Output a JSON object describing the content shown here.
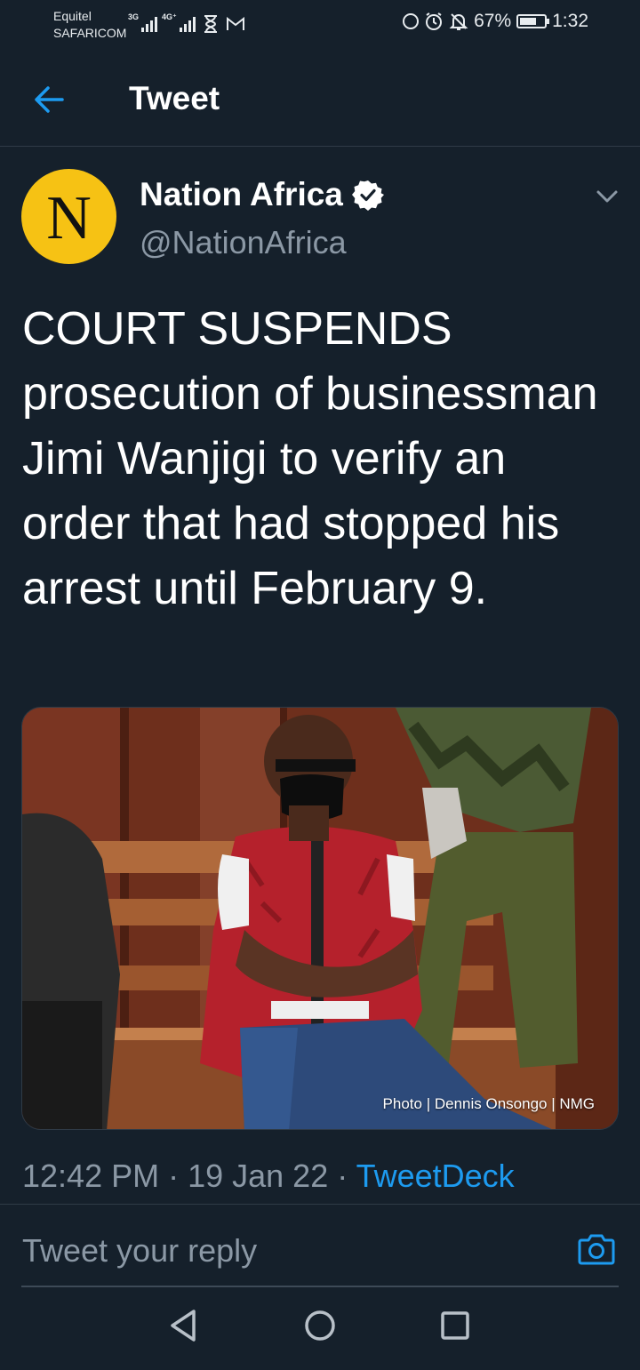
{
  "status_bar": {
    "carrier_name": "Equitel",
    "carrier_network": "SAFARICOM",
    "network_1": "3G",
    "network_2": "4G⁺",
    "battery_percent": "67%",
    "battery_level": 0.67,
    "time": "1:32"
  },
  "header": {
    "title": "Tweet"
  },
  "tweet": {
    "avatar_letter": "N",
    "display_name": "Nation Africa",
    "handle": "@NationAfrica",
    "text": "COURT SUSPENDS prosecution of businessman Jimi Wanjigi to verify an order that had stopped his arrest until February 9.",
    "photo_credit": "Photo | Dennis Onsongo | NMG",
    "time": "12:42 PM",
    "separator": " · ",
    "date": "19 Jan 22",
    "source": "TweetDeck"
  },
  "reply": {
    "placeholder": "Tweet your reply"
  },
  "colors": {
    "background": "#15202b",
    "accent": "#1d9bf0",
    "secondary_text": "#8b98a5",
    "avatar": "#f6c214"
  },
  "icons": {
    "back": "arrow-left-icon",
    "verified": "verified-badge-icon",
    "more": "chevron-down-icon",
    "camera": "camera-icon",
    "nav_back": "triangle-back-icon",
    "nav_home": "circle-home-icon",
    "nav_recents": "square-recents-icon"
  }
}
